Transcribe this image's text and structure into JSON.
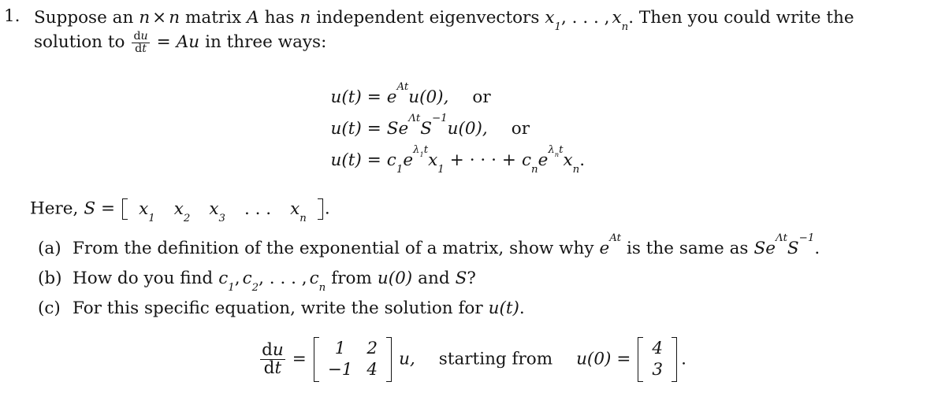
{
  "document": {
    "type": "math-problem-set",
    "background_color": "#ffffff",
    "text_color": "#151515"
  },
  "problem": {
    "number": "1.",
    "statement": {
      "line1_part1": "Suppose an",
      "var_n_a": "n",
      "times": "×",
      "var_n_b": "n",
      "line1_part2": "matrix",
      "var_A": "A",
      "line1_part3": "has",
      "var_n_c": "n",
      "line1_part4": "independent eigenvectors",
      "eigv_x": "x",
      "eigv_sub1": "1",
      "eigv_comma_dots": ", . . . ,",
      "eigv_xn": "x",
      "eigv_subn": "n",
      "line1_part5": ". Then you could write the",
      "line2_part1": "solution to",
      "frac_num": "du",
      "frac_den": "dt",
      "equals": "=",
      "Au": "Au",
      "line2_part2": "in three ways:"
    },
    "equations": [
      {
        "id": "eq1",
        "lhs": "u(t)",
        "rel": "=",
        "rhs_base": "e",
        "rhs_exp": "At",
        "rhs_tail": "u(0),",
        "trailing": "or"
      },
      {
        "id": "eq2",
        "lhs": "u(t)",
        "rel": "=",
        "rhs_S1": "S",
        "rhs_base": "e",
        "rhs_exp": "Λt",
        "rhs_S2": "S",
        "rhs_S2_exp": "−1",
        "rhs_tail": "u(0),",
        "trailing": "or"
      },
      {
        "id": "eq3",
        "lhs": "u(t)",
        "rel": "=",
        "c1": "c",
        "c1_sub": "1",
        "e1": "e",
        "lambda1": "λ",
        "lambda1_sub": "1",
        "t1": "t",
        "x1": "x",
        "x1_sub": "1",
        "plus1": "+",
        "dots": "· · ·",
        "plus2": "+",
        "cn": "c",
        "cn_sub": "n",
        "en": "e",
        "lambdan": "λ",
        "lambdan_sub": "n",
        "tn": "t",
        "xn": "x",
        "xn_sub": "n",
        "period": "."
      }
    ],
    "here_line": {
      "prefix": "Here,",
      "var_S": "S",
      "equals": "=",
      "row_vector": [
        "x₁",
        "x₂",
        "x₃",
        ". . .",
        "xₙ"
      ],
      "row_vector_parts": [
        {
          "base": "x",
          "sub": "1"
        },
        {
          "base": "x",
          "sub": "2"
        },
        {
          "base": "x",
          "sub": "3"
        },
        {
          "base": ". . .",
          "sub": ""
        },
        {
          "base": "x",
          "sub": "n"
        }
      ],
      "period": "."
    },
    "subparts": [
      {
        "label": "(a)",
        "text_1": "From the definition of the exponential of a matrix, show why",
        "math_e": "e",
        "math_e_exp": "At",
        "text_2": "is the same as",
        "math_S1": "S",
        "math_e2": "e",
        "math_e2_exp": "Λt",
        "math_S2": "S",
        "math_S2_exp": "−1",
        "period": "."
      },
      {
        "label": "(b)",
        "text_1": "How do you find",
        "c1": "c",
        "c1_sub": "1",
        "comma1": ",",
        "c2": "c",
        "c2_sub": "2",
        "dots": ", . . . ,",
        "cn": "c",
        "cn_sub": "n",
        "text_2": "from",
        "u0": "u(0)",
        "text_3": "and",
        "S": "S",
        "question": "?"
      },
      {
        "label": "(c)",
        "text_1": "For this specific equation, write the solution for",
        "ut": "u(t)",
        "period": "."
      }
    ],
    "final_equation": {
      "frac_num": "du",
      "frac_den": "dt",
      "equals_1": "=",
      "matrix_A": [
        [
          "1",
          "2"
        ],
        [
          "−1",
          "4"
        ]
      ],
      "var_u": "u,",
      "middle_text": "starting from",
      "u0_label": "u(0)",
      "equals_2": "=",
      "vector_u0": [
        [
          "4"
        ],
        [
          "3"
        ]
      ],
      "period": "."
    }
  }
}
